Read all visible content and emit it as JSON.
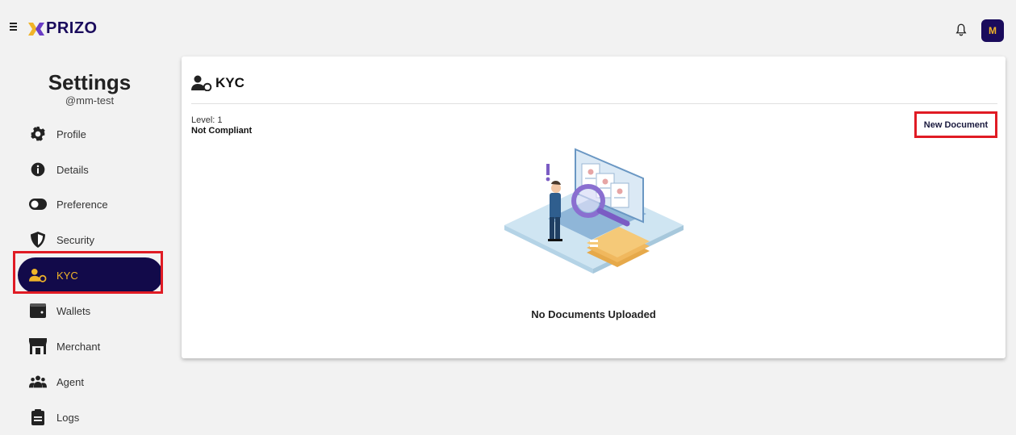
{
  "app": {
    "brand": "PRIZO",
    "avatar_initial": "M"
  },
  "colors": {
    "brand_navy": "#120a4a",
    "accent_gold": "#f0b429",
    "highlight_red": "#e01b24"
  },
  "sidebar": {
    "title": "Settings",
    "username": "@mm-test",
    "items": [
      {
        "label": "Profile",
        "icon": "gear-icon"
      },
      {
        "label": "Details",
        "icon": "info-icon"
      },
      {
        "label": "Preference",
        "icon": "toggle-icon"
      },
      {
        "label": "Security",
        "icon": "shield-icon"
      },
      {
        "label": "KYC",
        "icon": "user-verified-icon",
        "active": true
      },
      {
        "label": "Wallets",
        "icon": "wallet-icon"
      },
      {
        "label": "Merchant",
        "icon": "store-icon"
      },
      {
        "label": "Agent",
        "icon": "group-icon"
      },
      {
        "label": "Logs",
        "icon": "clipboard-icon"
      }
    ]
  },
  "main": {
    "title": "KYC",
    "level": "Level: 1",
    "compliance": "Not Compliant",
    "new_document_label": "New Document",
    "empty_message": "No Documents Uploaded"
  }
}
